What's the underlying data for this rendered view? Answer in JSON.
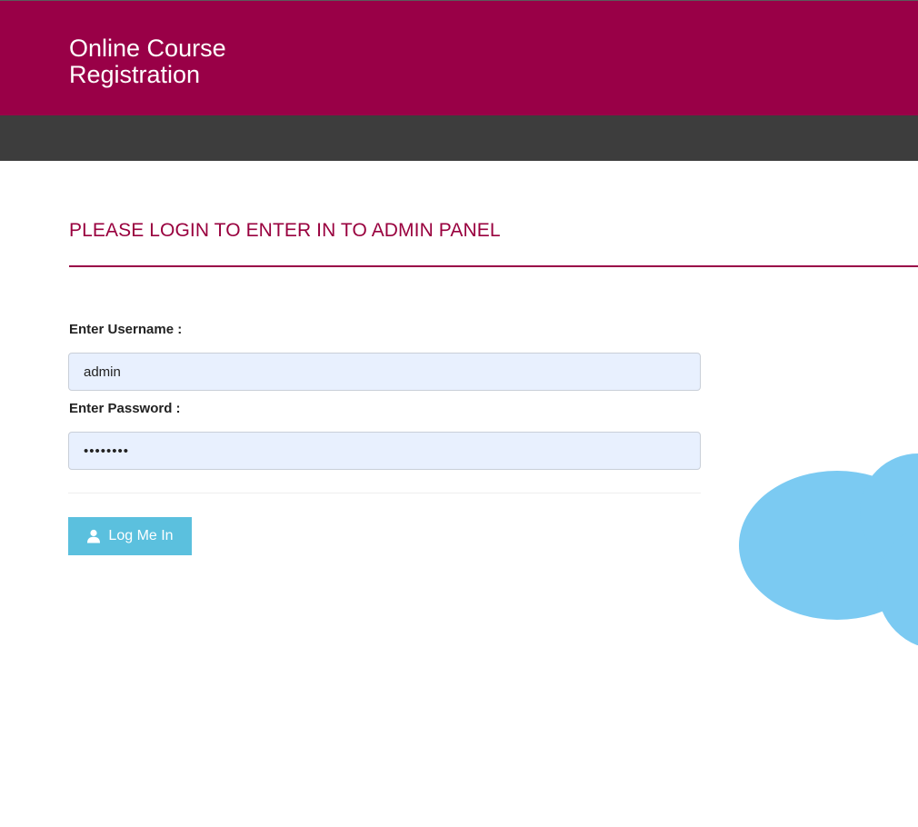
{
  "header": {
    "brand_line1": "Online Course",
    "brand_line2": "Registration"
  },
  "main": {
    "title": "PLEASE LOGIN TO ENTER IN TO ADMIN PANEL",
    "username_label": "Enter Username :",
    "username_value": "admin",
    "password_label": "Enter Password :",
    "password_value": "••••••••",
    "login_button_label": "Log Me In",
    "login_button_icon": "user-icon"
  },
  "decoration": {
    "cloud_icon": "cloud-icon"
  },
  "colors": {
    "header_bg": "#990047",
    "navbar_bg": "#3d3d3d",
    "title_color": "#99003e",
    "button_bg": "#5bc0de",
    "cloud_color": "#7bcaf2",
    "input_bg": "#e8f0fe"
  }
}
